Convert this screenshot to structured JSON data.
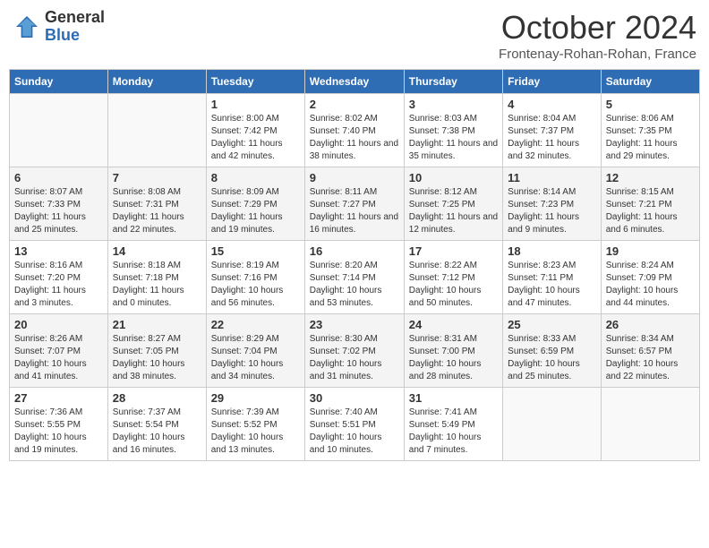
{
  "header": {
    "logo_general": "General",
    "logo_blue": "Blue",
    "month_title": "October 2024",
    "location": "Frontenay-Rohan-Rohan, France"
  },
  "calendar": {
    "days_of_week": [
      "Sunday",
      "Monday",
      "Tuesday",
      "Wednesday",
      "Thursday",
      "Friday",
      "Saturday"
    ],
    "weeks": [
      [
        {
          "day": "",
          "empty": true
        },
        {
          "day": "",
          "empty": true
        },
        {
          "day": "1",
          "sunrise": "Sunrise: 8:00 AM",
          "sunset": "Sunset: 7:42 PM",
          "daylight": "Daylight: 11 hours and 42 minutes."
        },
        {
          "day": "2",
          "sunrise": "Sunrise: 8:02 AM",
          "sunset": "Sunset: 7:40 PM",
          "daylight": "Daylight: 11 hours and 38 minutes."
        },
        {
          "day": "3",
          "sunrise": "Sunrise: 8:03 AM",
          "sunset": "Sunset: 7:38 PM",
          "daylight": "Daylight: 11 hours and 35 minutes."
        },
        {
          "day": "4",
          "sunrise": "Sunrise: 8:04 AM",
          "sunset": "Sunset: 7:37 PM",
          "daylight": "Daylight: 11 hours and 32 minutes."
        },
        {
          "day": "5",
          "sunrise": "Sunrise: 8:06 AM",
          "sunset": "Sunset: 7:35 PM",
          "daylight": "Daylight: 11 hours and 29 minutes."
        }
      ],
      [
        {
          "day": "6",
          "sunrise": "Sunrise: 8:07 AM",
          "sunset": "Sunset: 7:33 PM",
          "daylight": "Daylight: 11 hours and 25 minutes."
        },
        {
          "day": "7",
          "sunrise": "Sunrise: 8:08 AM",
          "sunset": "Sunset: 7:31 PM",
          "daylight": "Daylight: 11 hours and 22 minutes."
        },
        {
          "day": "8",
          "sunrise": "Sunrise: 8:09 AM",
          "sunset": "Sunset: 7:29 PM",
          "daylight": "Daylight: 11 hours and 19 minutes."
        },
        {
          "day": "9",
          "sunrise": "Sunrise: 8:11 AM",
          "sunset": "Sunset: 7:27 PM",
          "daylight": "Daylight: 11 hours and 16 minutes."
        },
        {
          "day": "10",
          "sunrise": "Sunrise: 8:12 AM",
          "sunset": "Sunset: 7:25 PM",
          "daylight": "Daylight: 11 hours and 12 minutes."
        },
        {
          "day": "11",
          "sunrise": "Sunrise: 8:14 AM",
          "sunset": "Sunset: 7:23 PM",
          "daylight": "Daylight: 11 hours and 9 minutes."
        },
        {
          "day": "12",
          "sunrise": "Sunrise: 8:15 AM",
          "sunset": "Sunset: 7:21 PM",
          "daylight": "Daylight: 11 hours and 6 minutes."
        }
      ],
      [
        {
          "day": "13",
          "sunrise": "Sunrise: 8:16 AM",
          "sunset": "Sunset: 7:20 PM",
          "daylight": "Daylight: 11 hours and 3 minutes."
        },
        {
          "day": "14",
          "sunrise": "Sunrise: 8:18 AM",
          "sunset": "Sunset: 7:18 PM",
          "daylight": "Daylight: 11 hours and 0 minutes."
        },
        {
          "day": "15",
          "sunrise": "Sunrise: 8:19 AM",
          "sunset": "Sunset: 7:16 PM",
          "daylight": "Daylight: 10 hours and 56 minutes."
        },
        {
          "day": "16",
          "sunrise": "Sunrise: 8:20 AM",
          "sunset": "Sunset: 7:14 PM",
          "daylight": "Daylight: 10 hours and 53 minutes."
        },
        {
          "day": "17",
          "sunrise": "Sunrise: 8:22 AM",
          "sunset": "Sunset: 7:12 PM",
          "daylight": "Daylight: 10 hours and 50 minutes."
        },
        {
          "day": "18",
          "sunrise": "Sunrise: 8:23 AM",
          "sunset": "Sunset: 7:11 PM",
          "daylight": "Daylight: 10 hours and 47 minutes."
        },
        {
          "day": "19",
          "sunrise": "Sunrise: 8:24 AM",
          "sunset": "Sunset: 7:09 PM",
          "daylight": "Daylight: 10 hours and 44 minutes."
        }
      ],
      [
        {
          "day": "20",
          "sunrise": "Sunrise: 8:26 AM",
          "sunset": "Sunset: 7:07 PM",
          "daylight": "Daylight: 10 hours and 41 minutes."
        },
        {
          "day": "21",
          "sunrise": "Sunrise: 8:27 AM",
          "sunset": "Sunset: 7:05 PM",
          "daylight": "Daylight: 10 hours and 38 minutes."
        },
        {
          "day": "22",
          "sunrise": "Sunrise: 8:29 AM",
          "sunset": "Sunset: 7:04 PM",
          "daylight": "Daylight: 10 hours and 34 minutes."
        },
        {
          "day": "23",
          "sunrise": "Sunrise: 8:30 AM",
          "sunset": "Sunset: 7:02 PM",
          "daylight": "Daylight: 10 hours and 31 minutes."
        },
        {
          "day": "24",
          "sunrise": "Sunrise: 8:31 AM",
          "sunset": "Sunset: 7:00 PM",
          "daylight": "Daylight: 10 hours and 28 minutes."
        },
        {
          "day": "25",
          "sunrise": "Sunrise: 8:33 AM",
          "sunset": "Sunset: 6:59 PM",
          "daylight": "Daylight: 10 hours and 25 minutes."
        },
        {
          "day": "26",
          "sunrise": "Sunrise: 8:34 AM",
          "sunset": "Sunset: 6:57 PM",
          "daylight": "Daylight: 10 hours and 22 minutes."
        }
      ],
      [
        {
          "day": "27",
          "sunrise": "Sunrise: 7:36 AM",
          "sunset": "Sunset: 5:55 PM",
          "daylight": "Daylight: 10 hours and 19 minutes."
        },
        {
          "day": "28",
          "sunrise": "Sunrise: 7:37 AM",
          "sunset": "Sunset: 5:54 PM",
          "daylight": "Daylight: 10 hours and 16 minutes."
        },
        {
          "day": "29",
          "sunrise": "Sunrise: 7:39 AM",
          "sunset": "Sunset: 5:52 PM",
          "daylight": "Daylight: 10 hours and 13 minutes."
        },
        {
          "day": "30",
          "sunrise": "Sunrise: 7:40 AM",
          "sunset": "Sunset: 5:51 PM",
          "daylight": "Daylight: 10 hours and 10 minutes."
        },
        {
          "day": "31",
          "sunrise": "Sunrise: 7:41 AM",
          "sunset": "Sunset: 5:49 PM",
          "daylight": "Daylight: 10 hours and 7 minutes."
        },
        {
          "day": "",
          "empty": true
        },
        {
          "day": "",
          "empty": true
        }
      ]
    ]
  }
}
